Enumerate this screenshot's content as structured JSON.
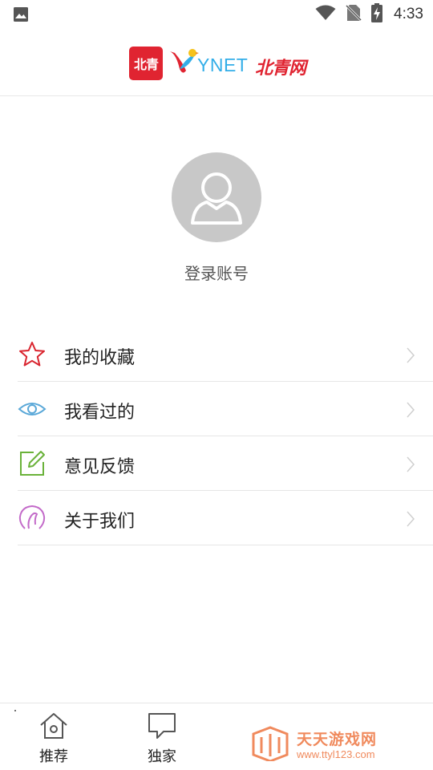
{
  "status_bar": {
    "time": "4:33",
    "icons": [
      "image-icon",
      "wifi-icon",
      "no-sim-icon",
      "battery-charging-icon"
    ]
  },
  "header": {
    "logo_badge": "北青",
    "logo_ynet": "YNET",
    "logo_cn": "北青网"
  },
  "profile": {
    "login_label": "登录账号"
  },
  "menu": {
    "items": [
      {
        "label": "我的收藏",
        "icon": "star-icon",
        "color": "#d9252f"
      },
      {
        "label": "我看过的",
        "icon": "eye-icon",
        "color": "#5aa8d8"
      },
      {
        "label": "意见反馈",
        "icon": "edit-icon",
        "color": "#6ab23a"
      },
      {
        "label": "关于我们",
        "icon": "about-icon",
        "color": "#c36bc9"
      }
    ]
  },
  "tabbar": {
    "tabs": [
      {
        "label": "推荐",
        "icon": "home-icon"
      },
      {
        "label": "独家",
        "icon": "chat-icon"
      }
    ],
    "watermark": {
      "title": "天天游戏网",
      "url": "www.ttyl123.com"
    }
  }
}
